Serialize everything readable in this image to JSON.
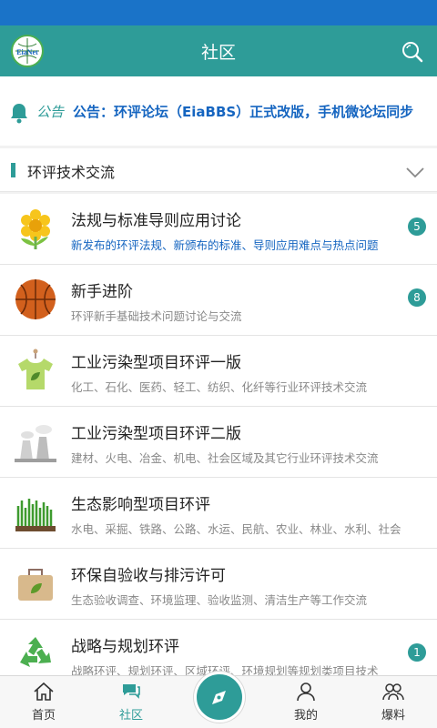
{
  "header": {
    "title": "社区"
  },
  "notice": {
    "tag": "公告",
    "text": "公告：环评论坛（EiaBBS）正式改版，手机微论坛同步"
  },
  "section": {
    "title": "环评技术交流"
  },
  "forums": [
    {
      "name": "法规与标准导则应用讨论",
      "desc": "新发布的环评法规、新颁布的标准、导则应用难点与热点问题",
      "badge": "5",
      "icon": "sunflower-icon"
    },
    {
      "name": "新手进阶",
      "desc": "环评新手基础技术问题讨论与交流",
      "badge": "8",
      "icon": "basketball-icon"
    },
    {
      "name": "工业污染型项目环评一版",
      "desc": "化工、石化、医药、轻工、纺织、化纤等行业环评技术交流",
      "badge": "",
      "icon": "tshirt-leaf-icon"
    },
    {
      "name": "工业污染型项目环评二版",
      "desc": "建材、火电、冶金、机电、社会区域及其它行业环评技术交流",
      "badge": "",
      "icon": "factory-icon"
    },
    {
      "name": "生态影响型项目环评",
      "desc": "水电、采掘、铁路、公路、水运、民航、农业、林业、水利、社会",
      "badge": "",
      "icon": "grass-icon"
    },
    {
      "name": "环保自验收与排污许可",
      "desc": "生态验收调查、环境监理、验收监测、清洁生产等工作交流",
      "badge": "",
      "icon": "eco-bag-icon"
    },
    {
      "name": "战略与规划环评",
      "desc": "战略环评、规划环评、区域环评、环境规划等规划类项目技术",
      "badge": "1",
      "icon": "recycle-icon"
    }
  ],
  "bottom_nav": [
    {
      "label": "首页",
      "icon": "home-icon",
      "active": false
    },
    {
      "label": "社区",
      "icon": "community-icon",
      "active": true
    },
    {
      "label": "我的",
      "icon": "user-icon",
      "active": false
    },
    {
      "label": "爆料",
      "icon": "report-icon",
      "active": false
    }
  ],
  "colors": {
    "theme": "#2e9c98",
    "status_bar": "#1a73c8",
    "notice_text": "#1565c0"
  }
}
